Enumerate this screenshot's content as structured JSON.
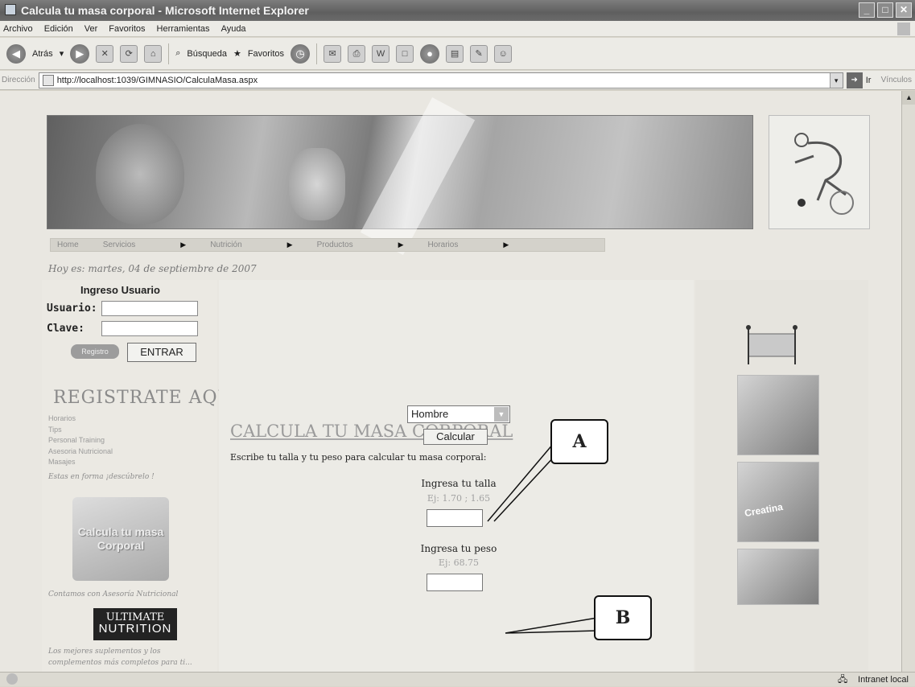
{
  "window": {
    "title": "Calcula tu masa corporal - Microsoft Internet Explorer"
  },
  "menu": [
    "Archivo",
    "Edición",
    "Ver",
    "Favoritos",
    "Herramientas",
    "Ayuda"
  ],
  "toolbar": {
    "back_label": "Atrás",
    "search_label": "Búsqueda",
    "favorites_label": "Favoritos"
  },
  "address": {
    "label": "Dirección",
    "url": "http://localhost:1039/GIMNASIO/CalculaMasa.aspx",
    "go_label": "Ir",
    "links_label": "Vínculos"
  },
  "nav": {
    "items": [
      {
        "label": "Home"
      },
      {
        "label": "Servicios"
      },
      {
        "label": "Nutrición"
      },
      {
        "label": "Productos"
      },
      {
        "label": "Horarios"
      }
    ]
  },
  "date_text": "Hoy es: martes, 04 de septiembre de 2007",
  "login": {
    "title": "Ingreso Usuario",
    "user_label": "Usuario:",
    "pass_label": "Clave:",
    "reg_label": "Registro",
    "enter_label": "ENTRAR"
  },
  "left": {
    "register_heading": "REGISTRATE AQUI",
    "menu": [
      "Horarios",
      "Tips",
      "Personal Training",
      "Asesoria Nutricional",
      "Masajes"
    ],
    "note_top": "Estas en forma ¡descúbrelo !",
    "badge_line1": "Calcula tu masa",
    "badge_line2": "Corporal",
    "note_mid": "Contamos con Asesoría Nutricional",
    "brand_line1": "ULTIMATE",
    "brand_line2": "NUTRITION",
    "note_bottom_1": "Los mejores suplementos y los",
    "note_bottom_2": "complementos más completos para ti..."
  },
  "form": {
    "title": "CALCULA TU MASA CORPORAL",
    "description": "Escribe tu talla y tu peso para calcular tu masa corporal:",
    "height_label": "Ingresa tu talla",
    "height_hint": "Ej: 1.70 ; 1.65",
    "weight_label": "Ingresa tu peso",
    "weight_hint": "Ej: 68.75",
    "gender_value": "Hombre",
    "calc_label": "Calcular"
  },
  "right": {
    "product_label": "Creatina"
  },
  "callouts": {
    "a": "A",
    "b": "B"
  },
  "status": {
    "zone_text": "Intranet local"
  }
}
